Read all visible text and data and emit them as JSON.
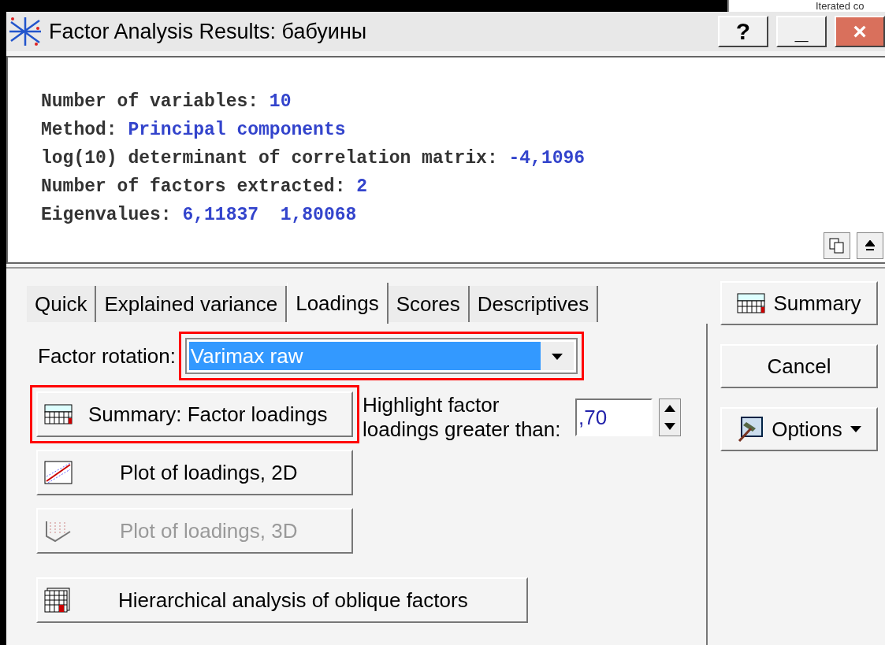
{
  "background_window": {
    "text": "Iterated co"
  },
  "window": {
    "title": "Factor Analysis Results: бабуины",
    "controls": [
      {
        "kind": "help",
        "label": "?"
      },
      {
        "kind": "minimize",
        "label": "_"
      },
      {
        "kind": "close",
        "label": "×"
      }
    ]
  },
  "output": {
    "lines": [
      {
        "label": "Number of variables:",
        "value": "10"
      },
      {
        "label": "Method:",
        "value": "Principal components"
      },
      {
        "label": "log(10) determinant of correlation matrix:",
        "value": "-4,1096"
      },
      {
        "label": "Number of factors extracted:",
        "value": "2"
      },
      {
        "label": "Eigenvalues:",
        "value": "6,11837  1,80068"
      }
    ]
  },
  "tabs": [
    {
      "label": "Quick",
      "selected": false
    },
    {
      "label": "Explained variance",
      "selected": false
    },
    {
      "label": "Loadings",
      "selected": true
    },
    {
      "label": "Scores",
      "selected": false
    },
    {
      "label": "Descriptives",
      "selected": false
    }
  ],
  "factor_rotation": {
    "label": "Factor rotation:",
    "value": "Varimax raw",
    "highlighted": true
  },
  "buttons": [
    {
      "kind": "table",
      "label": "Summary: Factor loadings",
      "disabled": false,
      "highlighted": true
    },
    {
      "kind": "plot2d",
      "label": "Plot of loadings, 2D",
      "disabled": false,
      "highlighted": false
    },
    {
      "kind": "plot3d",
      "label": "Plot of loadings, 3D",
      "disabled": true,
      "highlighted": false
    },
    {
      "kind": "grid",
      "label": "Hierarchical analysis of oblique factors",
      "disabled": false,
      "highlighted": false
    }
  ],
  "highlight": {
    "label": "Highlight factor loadings greater than:",
    "value": ",70"
  },
  "side_buttons": [
    {
      "kind": "summary",
      "label": "Summary"
    },
    {
      "kind": "plain",
      "label": "Cancel"
    },
    {
      "kind": "menu",
      "label": "Options"
    }
  ]
}
